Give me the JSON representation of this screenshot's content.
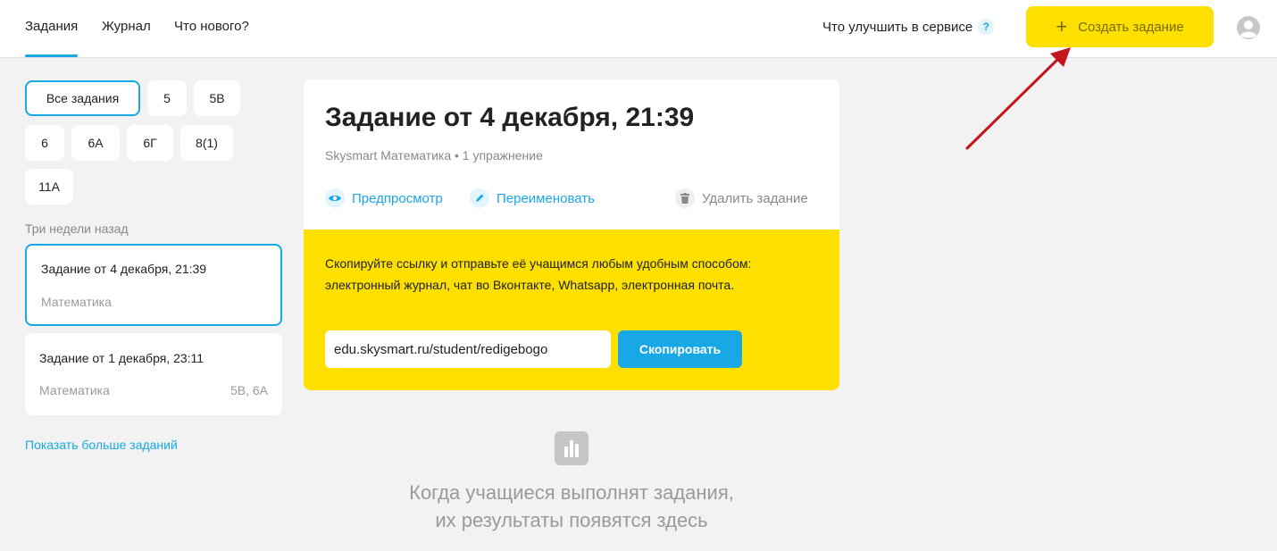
{
  "nav": {
    "tabs": [
      {
        "label": "Задания",
        "active": true
      },
      {
        "label": "Журнал",
        "active": false
      },
      {
        "label": "Что нового?",
        "active": false
      }
    ],
    "improve_label": "Что улучшить в сервисе",
    "help_badge": "?",
    "create_button": "Создать задание",
    "create_icon": "plus-icon",
    "avatar_icon": "user-avatar-icon"
  },
  "filters": [
    "Все задания",
    "5",
    "5В",
    "6",
    "6А",
    "6Г",
    "8(1)",
    "11А"
  ],
  "section_label": "Три недели назад",
  "tasks": [
    {
      "title": "Задание от 4 декабря, 21:39",
      "subject": "Математика",
      "classes": ""
    },
    {
      "title": "Задание от 1 декабря, 23:11",
      "subject": "Математика",
      "classes": "5В, 6А"
    }
  ],
  "show_more": "Показать больше заданий",
  "main": {
    "title": "Задание от 4 декабря, 21:39",
    "subtitle": "Skysmart Математика • 1 упражнение",
    "actions": {
      "preview": "Предпросмотр",
      "rename": "Переименовать",
      "delete": "Удалить задание"
    },
    "share_text": "Скопируйте ссылку и отправьте её учащимся любым удобным способом: электронный журнал, чат во Вконтакте, Whatsapp, электронная почта.",
    "link_value": "edu.skysmart.ru/student/redigebogo",
    "copy_button": "Скопировать"
  },
  "empty_state": {
    "line1": "Когда учащиеся выполнят задания,",
    "line2": "их результаты появятся здесь"
  },
  "colors": {
    "accent": "#19a8e6",
    "yellow": "#fde000",
    "annotation_arrow": "#c4141c"
  }
}
